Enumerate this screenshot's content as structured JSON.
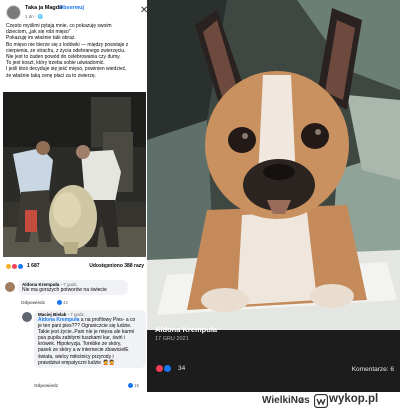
{
  "post": {
    "author": "Taka ja Magda",
    "follow_label": "Obserwuj",
    "time": "1 dn · ",
    "close_glyph": "✕",
    "text_lines": [
      "Często myślimi pytają mnie, co pokazuję swoim",
      "dzieciom, „jak się robi mięso\"",
      "Pokazuję im właśnie taki obraz.",
      "Bo mięso nie bierze się z lodówki — między powstaje z",
      "cierpienia, ze strachu, z życia odebranego zwierzęciu.",
      "Nie jest to żaden powód do celebrowania czy dumy.",
      "To jest koszt, który trzeba sobie uświadomić.",
      "I jeśli ktoś decyduje się jeść mięso, powinien wiedzieć,",
      "że właśnie taką cenę płaci za to zwierzę."
    ]
  },
  "reactions": {
    "count": "1 687",
    "shares": "Udostępniono 388 razy",
    "colors": [
      "#f7b125",
      "#f33e58",
      "#1877f2"
    ]
  },
  "comment1": {
    "name": "Aldona Krempuła",
    "time": "7 godz.",
    "text": "Nie ma gorszych potworów na świecie",
    "reply_label": "Odpowiedz",
    "likes": "42"
  },
  "comment2": {
    "name": "Maciej Bielak",
    "time": "7 godz.",
    "mention": "Aldona Krempuła",
    "first_line_rest": " a na profilowy Pies- a co",
    "lines": [
      "je ten pani pies??? Ograniczcie  się ludzie.",
      "Takie jest życie..Pani nie je mięsa ale karmi",
      "psa pupila zabitymi tuszkami kur, świń i",
      "krówek. Hipokryzja. Torebke ze skóry,",
      "pasek ze skóry a w internecie zbawicielE",
      "świata, wielcy miłośnicy przyrody i",
      "prawdziwi empatyczni ludzie 🤦🤦"
    ],
    "reply_label": "Odpowiedz",
    "likes": "15"
  },
  "photo": {
    "name": "Aldona Krempuła",
    "date": "17 GRU 2021",
    "reactions_count": "34",
    "comments": "Komentarze: 6"
  },
  "watermark": {
    "user": "WielkiNos",
    "z": "z",
    "site": "wykop.pl"
  }
}
